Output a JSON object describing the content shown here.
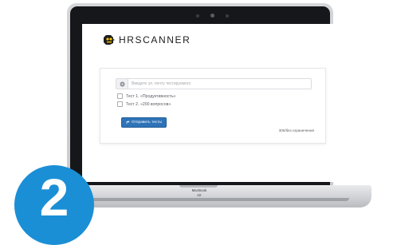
{
  "brand": {
    "name": "HRSCANNER",
    "logo_icon": "robot-head-icon"
  },
  "form": {
    "email_input": {
      "value": "",
      "placeholder": "Введите эл. почту тестируемого",
      "icon": "email-icon"
    },
    "tests": [
      {
        "label": "Тест 1. «Продуктивность»",
        "checked": false
      },
      {
        "label": "Тест 2. «200 вопросов»",
        "checked": false
      }
    ],
    "send_button": {
      "label": "Отправить тесты",
      "icon": "send-icon",
      "color": "#2e73b8"
    },
    "limit_note": "300/без ограничения"
  },
  "device": {
    "model": "MacBook Air"
  },
  "step": {
    "number": "2",
    "color": "#1a8fd6"
  }
}
